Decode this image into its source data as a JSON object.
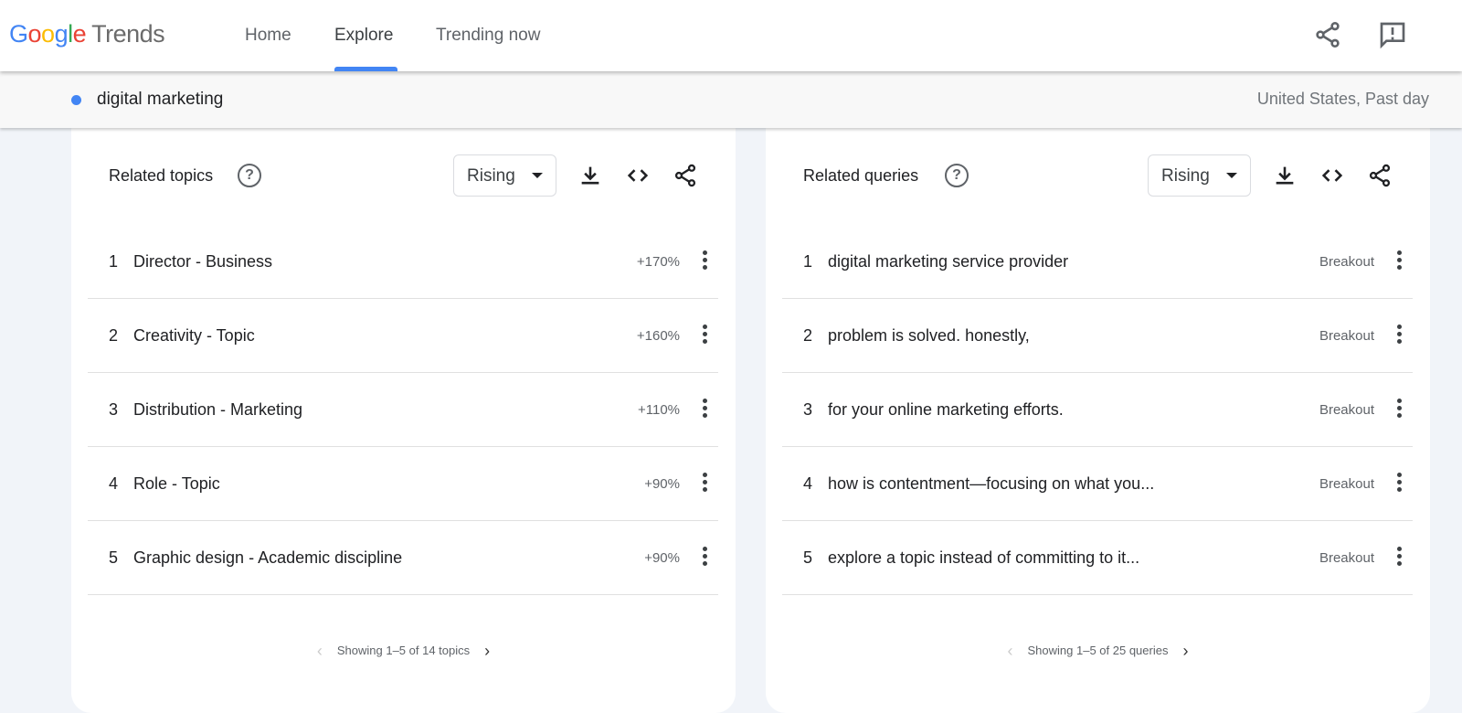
{
  "header": {
    "logo_google": "Google",
    "logo_trends": "Trends",
    "nav": [
      {
        "label": "Home"
      },
      {
        "label": "Explore",
        "active": true
      },
      {
        "label": "Trending now"
      }
    ],
    "icons": [
      "share-icon",
      "feedback-icon"
    ]
  },
  "search": {
    "term": "digital marketing",
    "term_color": "#4285f4",
    "location_time": "United States, Past day"
  },
  "topics": {
    "title": "Related topics",
    "filter": "Rising",
    "rows": [
      {
        "rank": "1",
        "label": "Director - Business",
        "value": "+170%"
      },
      {
        "rank": "2",
        "label": "Creativity - Topic",
        "value": "+160%"
      },
      {
        "rank": "3",
        "label": "Distribution - Marketing",
        "value": "+110%"
      },
      {
        "rank": "4",
        "label": "Role - Topic",
        "value": "+90%"
      },
      {
        "rank": "5",
        "label": "Graphic design - Academic discipline",
        "value": "+90%"
      }
    ],
    "pager": "Showing 1–5 of 14 topics"
  },
  "queries": {
    "title": "Related queries",
    "filter": "Rising",
    "rows": [
      {
        "rank": "1",
        "label": "digital marketing service provider",
        "value": "Breakout"
      },
      {
        "rank": "2",
        "label": "problem is solved. honestly,",
        "value": "Breakout"
      },
      {
        "rank": "3",
        "label": "for your online marketing efforts.",
        "value": "Breakout"
      },
      {
        "rank": "4",
        "label": "how is contentment—focusing on what you...",
        "value": "Breakout"
      },
      {
        "rank": "5",
        "label": "explore a topic instead of committing to it...",
        "value": "Breakout"
      }
    ],
    "pager": "Showing 1–5 of 25 queries"
  }
}
